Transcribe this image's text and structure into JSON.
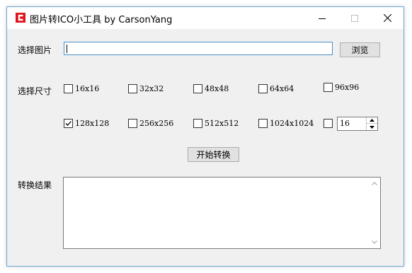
{
  "window": {
    "title": "图片转ICO小工具 by CarsonYang",
    "app_icon": "red-square-logo"
  },
  "titlebar_controls": [
    "minimize",
    "maximize",
    "close"
  ],
  "file_picker": {
    "label": "选择图片",
    "path_value": "",
    "browse_label": "浏览"
  },
  "sizes": {
    "label": "选择尺寸",
    "options": [
      {
        "label": "16x16",
        "checked": false
      },
      {
        "label": "32x32",
        "checked": false
      },
      {
        "label": "48x48",
        "checked": false
      },
      {
        "label": "64x64",
        "checked": false
      },
      {
        "label": "96x96",
        "checked": false
      },
      {
        "label": "128x128",
        "checked": true
      },
      {
        "label": "256x256",
        "checked": false
      },
      {
        "label": "512x512",
        "checked": false
      },
      {
        "label": "1024x1024",
        "checked": false
      }
    ],
    "custom": {
      "checked": false,
      "value": "16"
    }
  },
  "convert_button": "开始转换",
  "result": {
    "label": "转换结果",
    "text": ""
  },
  "colors": {
    "accent_border": "#4a90c8",
    "app_icon_red": "#e0141e",
    "window_bg": "#f0f0f0"
  }
}
